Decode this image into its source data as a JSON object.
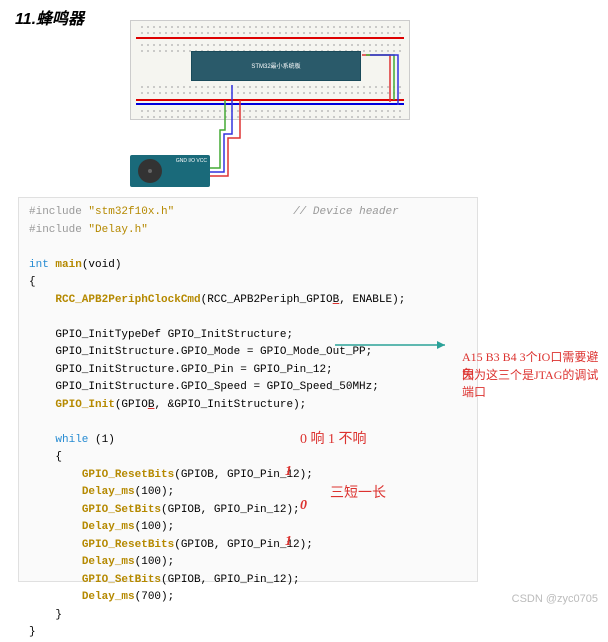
{
  "title": "11.蜂鸣器",
  "chip_label": "STM32最小系统板",
  "buzzer_pins": "GND\nI/O\nVCC",
  "code": {
    "include1_pre": "#include ",
    "include1_str": "\"stm32f10x.h\"",
    "include1_comment": "// Device header",
    "include2_pre": "#include ",
    "include2_str": "\"Delay.h\"",
    "ret_type": "int ",
    "main_name": "main",
    "main_args": "(void)",
    "brace_open": "{",
    "rcc_call": "RCC_APB2PeriphClockCmd",
    "rcc_args_pre": "(RCC_APB2Periph_GPIO",
    "rcc_args_b": "B",
    "rcc_args_post": ", ENABLE);",
    "decl": "GPIO_InitTypeDef GPIO_InitStructure;",
    "mode_line": "GPIO_InitStructure.GPIO_Mode = GPIO_Mode_Out_PP;",
    "pin_line": "GPIO_InitStructure.GPIO_Pin = GPIO_Pin_12;",
    "speed_line": "GPIO_InitStructure.GPIO_Speed = GPIO_Speed_50MHz;",
    "init_call": "GPIO_Init",
    "init_args_pre": "(GPIO",
    "init_args_b": "B",
    "init_args_post": ", &GPIO_InitStructure);",
    "while_kw": "while",
    "while_cond": " (1)",
    "reset_call": "GPIO_ResetBits",
    "set_call": "GPIO_SetBits",
    "gpio_args": "(GPIOB, GPIO_Pin_12);",
    "delay_call": "Delay_ms",
    "delay100": "(100);",
    "delay700": "(700);",
    "brace_close": "}"
  },
  "annotations": {
    "note1_line1": "A15 B3 B4 3个IO口需要避免",
    "note1_line2": "因为这三个是JTAG的调试端口",
    "note2": "0 响 1 不响",
    "note3": "三短一长",
    "zero": "0",
    "one": "1"
  },
  "watermark": "CSDN @zyc0705"
}
